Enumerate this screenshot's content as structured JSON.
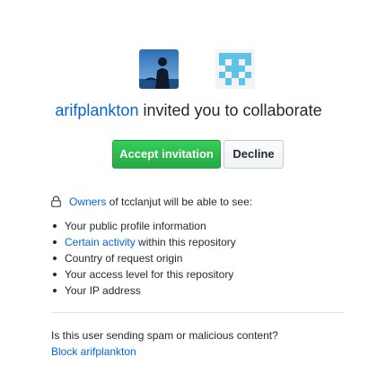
{
  "invite": {
    "inviter": "arifplankton",
    "headline_rest": " invited you to collaborate"
  },
  "actions": {
    "accept_label": "Accept invitation",
    "decline_label": "Decline"
  },
  "permissions": {
    "owners_link": "Owners",
    "owners_text": " of tcclanjut will be able to see:",
    "items": [
      {
        "text": "Your public profile information"
      },
      {
        "link": "Certain activity",
        "text": " within this repository"
      },
      {
        "text": "Country of request origin"
      },
      {
        "text": "Your access level for this repository"
      },
      {
        "text": "Your IP address"
      }
    ]
  },
  "spam": {
    "question": "Is this user sending spam or malicious content?",
    "block_label": "Block arifplankton"
  },
  "icons": {
    "lock": "lock-icon",
    "user_avatar": "user-avatar",
    "repo_avatar": "identicon-avatar"
  },
  "colors": {
    "link": "#0366d6",
    "accept": "#28a745",
    "repo_identicon": "#5fc2e6"
  }
}
